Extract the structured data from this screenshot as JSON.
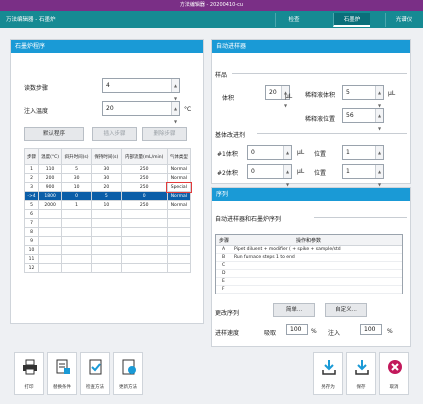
{
  "window": {
    "title": "方法编辑器 - 20200410-cu"
  },
  "nav": {
    "breadcrumb": "万法编辑器 - 石墨炉",
    "tabs": [
      "检查",
      "石墨炉",
      "光谱仪"
    ],
    "active_index": 1
  },
  "furnace": {
    "header": "石墨炉程序",
    "dry_steps_label": "读数步骤",
    "dry_steps_value": "4",
    "inject_temp_label": "注入温度",
    "inject_temp_value": "20",
    "inject_temp_unit": "°C",
    "default_button": "默认程序",
    "insert_button": "插入步骤",
    "delete_button": "删除步骤",
    "columns": [
      "步骤",
      "温度(°C)",
      "斜升时间(s)",
      "保持时间(s)",
      "内部流量(mL/min)",
      "气体类型"
    ],
    "rows": [
      [
        "1",
        "110",
        "5",
        "30",
        "250",
        "Normal"
      ],
      [
        "2",
        "200",
        "30",
        "30",
        "250",
        "Normal"
      ],
      [
        "3",
        "900",
        "10",
        "20",
        "250",
        "Special"
      ],
      [
        "->4",
        "1800",
        "0",
        "5",
        "0",
        "Normal"
      ],
      [
        "5",
        "2000",
        "1",
        "10",
        "250",
        "Normal"
      ],
      [
        "6",
        "",
        "",
        "",
        "",
        ""
      ],
      [
        "7",
        "",
        "",
        "",
        "",
        ""
      ],
      [
        "8",
        "",
        "",
        "",
        "",
        ""
      ],
      [
        "9",
        "",
        "",
        "",
        "",
        ""
      ],
      [
        "10",
        "",
        "",
        "",
        "",
        ""
      ],
      [
        "11",
        "",
        "",
        "",
        "",
        ""
      ],
      [
        "12",
        "",
        "",
        "",
        "",
        ""
      ]
    ]
  },
  "autosampler": {
    "header": "自动进样器",
    "sample_section": "样品",
    "volume_label": "体积",
    "volume_value": "20",
    "volume_unit": "μL",
    "diluent_volume_label": "稀释液体积",
    "diluent_volume_value": "5",
    "diluent_volume_unit": "μL",
    "diluent_position_label": "稀释液位置",
    "diluent_position_value": "56",
    "modifier_section": "基体改进剂",
    "mod1_label": "#1体积",
    "mod1_value": "0",
    "mod1_unit": "μL",
    "mod1_pos_label": "位置",
    "mod1_pos_value": "1",
    "mod2_label": "#2体积",
    "mod2_value": "0",
    "mod2_unit": "μL",
    "mod2_pos_label": "位置",
    "mod2_pos_value": "1"
  },
  "sequence": {
    "header": "序列",
    "subtitle": "自动进样器和石墨炉序列",
    "columns": [
      "步骤",
      "操作和参数"
    ],
    "rows": [
      [
        "A",
        "Pipet diluent + modifier ( + spike + sample/std"
      ],
      [
        "B",
        "Run furnace steps 1 to end"
      ],
      [
        "C",
        ""
      ],
      [
        "D",
        ""
      ],
      [
        "E",
        ""
      ],
      [
        "F",
        ""
      ]
    ],
    "change_label": "更改序列",
    "simple_button": "简单...",
    "custom_button": "自定义...",
    "speed_label": "进样速度",
    "aspirate_label": "吸取",
    "aspirate_value": "100",
    "aspirate_unit": "%",
    "inject_label": "注入",
    "inject_value": "100",
    "inject_unit": "%"
  },
  "bottom": {
    "print": "打印",
    "replace": "替换条件",
    "check": "检查方法",
    "update": "更新方法",
    "save_as": "另存为",
    "save": "保存",
    "cancel": "取消"
  },
  "colors": {
    "titlebar": "#7a2f86",
    "navbar": "#168a93",
    "panel_header": "#1a9ad6",
    "selected_row": "#0b5ea8",
    "special_outline": "#e23b3b"
  }
}
